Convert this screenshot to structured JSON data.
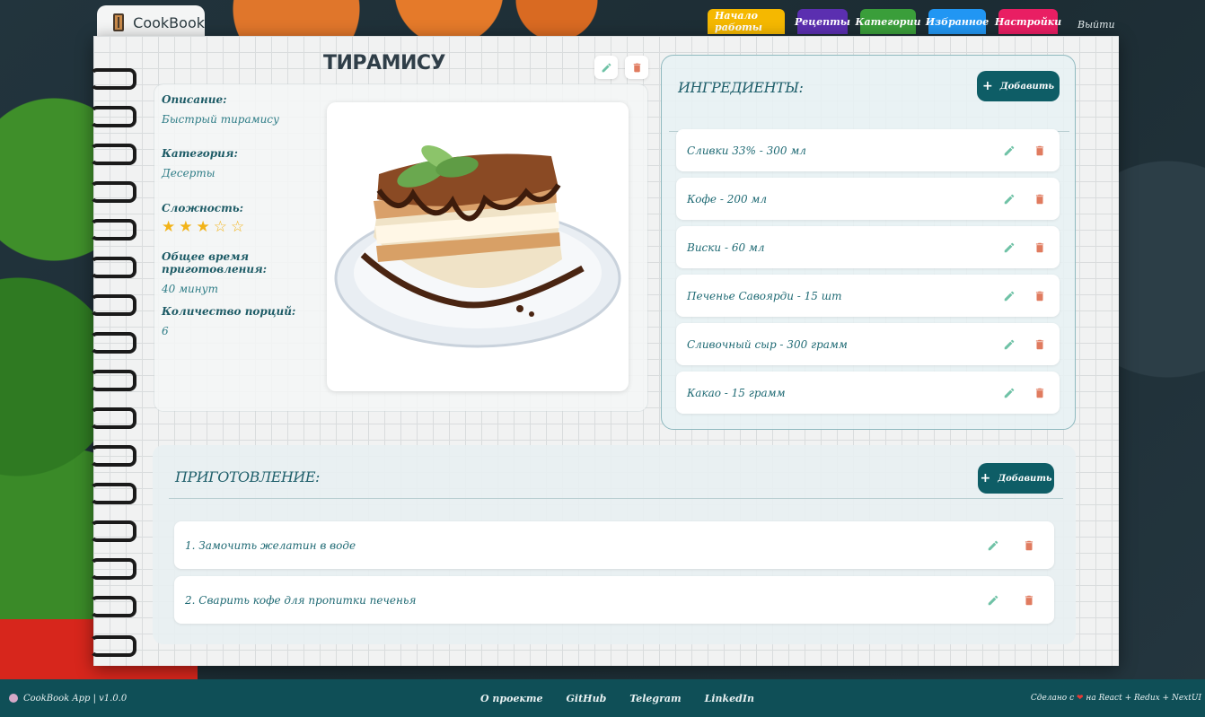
{
  "app": {
    "name": "CookBook"
  },
  "nav": {
    "tabs": [
      {
        "label": "Начало работы",
        "color": "#f5b800"
      },
      {
        "label": "Рецепты",
        "color": "#5b2fb0"
      },
      {
        "label": "Категории",
        "color": "#3a9e3a"
      },
      {
        "label": "Избранное",
        "color": "#2196f3"
      },
      {
        "label": "Настройки",
        "color": "#e91e63"
      }
    ],
    "logout": "Выйти"
  },
  "recipe": {
    "title": "ТИРАМИСУ",
    "description_label": "Описание:",
    "description": "Быстрый тирамису",
    "category_label": "Категория:",
    "category": "Десерты",
    "difficulty_label": "Сложность:",
    "difficulty": 3,
    "difficulty_max": 5,
    "time_label": "Общее время приготовления:",
    "time": "40 минут",
    "servings_label": "Количество порций:",
    "servings": "6"
  },
  "ingredients": {
    "title": "ИНГРЕДИЕНТЫ:",
    "add_label": "Добавить",
    "items": [
      "Сливки 33% - 300 мл",
      "Кофе - 200 мл",
      "Виски - 60 мл",
      "Печенье Савоярди - 15 шт",
      "Сливочный сыр - 300 грамм",
      "Какао - 15 грамм"
    ]
  },
  "preparation": {
    "title": "ПРИГОТОВЛЕНИЕ:",
    "add_label": "Добавить",
    "steps": [
      "1. Замочить желатин в воде",
      "2. Сварить кофе для пропитки печенья"
    ]
  },
  "footer": {
    "app_version": "CookBook App | v1.0.0",
    "links": [
      "О проекте",
      "GitHub",
      "Telegram",
      "LinkedIn"
    ],
    "made_with_prefix": "Сделано с",
    "made_with_suffix": "на React + Redux + NextUI"
  },
  "colors": {
    "accent": "#0e5d66",
    "edit_icon": "#6fc2a6",
    "delete_icon": "#e07b5f",
    "star": "#f2b318"
  },
  "icons": [
    "book-icon",
    "pencil-icon",
    "trash-icon",
    "plus-icon",
    "star-icon",
    "heart-icon"
  ]
}
